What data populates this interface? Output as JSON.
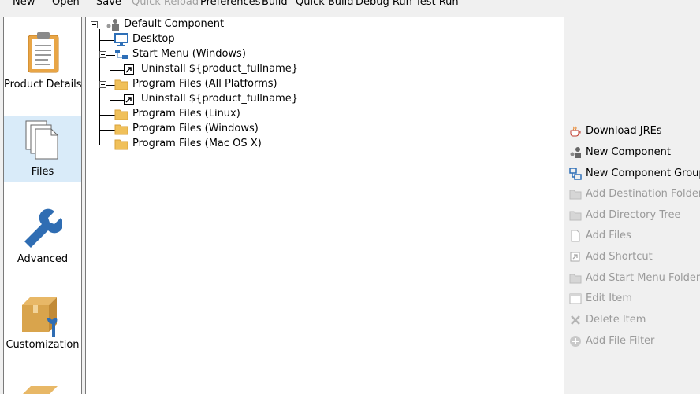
{
  "toolbar": {
    "new": "New",
    "open": "Open",
    "save": "Save",
    "quick_reload": "Quick Reload",
    "preferences": "Preferences",
    "build": "Build",
    "quick_build": "Quick Build",
    "debug_run": "Debug Run",
    "test_run": "Test Run"
  },
  "sidebar": {
    "items": [
      {
        "label": "Product Details",
        "icon": "clipboard-icon"
      },
      {
        "label": "Files",
        "icon": "files-icon",
        "selected": true
      },
      {
        "label": "Advanced",
        "icon": "wrench-icon"
      },
      {
        "label": "Customization",
        "icon": "box-wrench-icon"
      }
    ]
  },
  "tree": {
    "root": "Default Component",
    "desktop": "Desktop",
    "start_menu": "Start Menu (Windows)",
    "start_menu_uninstall": "Uninstall ${product_fullname}",
    "program_files_all": "Program Files (All Platforms)",
    "program_files_all_uninstall": "Uninstall ${product_fullname}",
    "program_files_linux": "Program Files (Linux)",
    "program_files_windows": "Program Files (Windows)",
    "program_files_mac": "Program Files (Mac OS X)"
  },
  "actions": {
    "download_jres": "Download JREs",
    "new_component": "New Component",
    "new_component_group": "New Component Group",
    "add_destination_folder": "Add Destination Folder",
    "add_directory_tree": "Add Directory Tree",
    "add_files": "Add Files",
    "add_shortcut": "Add Shortcut",
    "add_start_menu_folder": "Add Start Menu Folder",
    "edit_item": "Edit Item",
    "delete_item": "Delete Item",
    "add_file_filter": "Add File Filter"
  },
  "colors": {
    "selected_bg": "#d9ebf9",
    "folder": "#f0c05a",
    "accent_blue": "#2e6fb7",
    "disabled_text": "#9a9a9a"
  }
}
